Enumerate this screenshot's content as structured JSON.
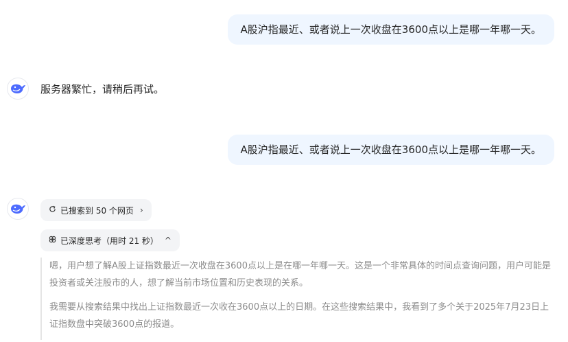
{
  "messages": {
    "user_1": "A股沪指最近、或者说上一次收盘在3600点以上是哪一年哪一天。",
    "assistant_1": "服务器繁忙，请稍后再试。",
    "user_2": "A股沪指最近、或者说上一次收盘在3600点以上是哪一年哪一天。"
  },
  "search_chip": {
    "icon": "refresh-search-icon",
    "label": "已搜索到 50 个网页",
    "arrow": "›"
  },
  "think_chip": {
    "icon": "think-icon",
    "label": "已深度思考（用时 21 秒）",
    "arrow": "^"
  },
  "thought": {
    "p1": "嗯，用户想了解A股上证指数最近一次收盘在3600点以上是在哪一年哪一天。这是一个非常具体的时间点查询问题，用户可能是投资者或关注股市的人，想了解当前市场位置和历史表现的关系。",
    "p2": "我需要从搜索结果中找出上证指数最近一次收在3600点以上的日期。在这些搜索结果中，我看到了多个关于2025年7月23日上证指数盘中突破3600点的报道。"
  },
  "colors": {
    "user_bubble": "#eff6ff",
    "chip_bg": "#f3f4f6",
    "accent_whale": "#4d6bfe",
    "thought_text": "#8b8b8b"
  }
}
